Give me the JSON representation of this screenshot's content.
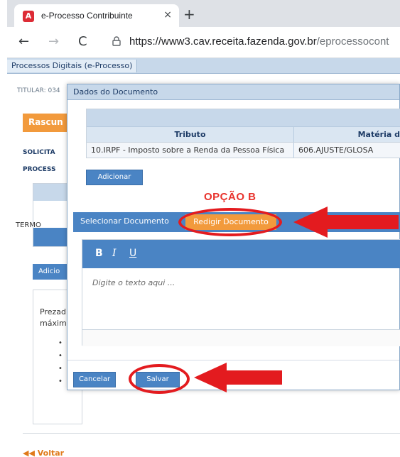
{
  "browser": {
    "tab_title": "e-Processo Contribuinte",
    "tab_close": "×",
    "new_tab": "+",
    "url_host": "https://www3.cav.receita.fazenda.gov.br",
    "url_path": "/eprocessocont",
    "back": "←",
    "forward": "→",
    "reload": "C"
  },
  "page": {
    "breadcrumb": "Processos Digitais (e-Processo)",
    "titular_label": "TITULAR: 034",
    "rascunho_label": "Rascun",
    "solicit_label": "SOLICITA",
    "process_label": "PROCESS",
    "termo_label": "TERMO",
    "adicionar_label": "Adicio",
    "prezado_text": "Prezad",
    "maxim_text": "máxim",
    "bullets": [
      "•",
      "•",
      "•",
      "•"
    ],
    "voltar_label": "Voltar"
  },
  "modal": {
    "title": "Dados do Documento",
    "table": {
      "headers": [
        "Tributo",
        "Matéria d"
      ],
      "rows": [
        [
          "10.IRPF - Imposto sobre a Renda da Pessoa Física",
          "606.AJUSTE/GLOSA"
        ]
      ]
    },
    "adicionar_button": "Adicionar",
    "selecionar_tab": "Selecionar Documento",
    "redigir_tab": "Redigir Documento",
    "editor": {
      "bold": "B",
      "italic": "I",
      "underline": "U",
      "placeholder": "Digite o texto aqui ..."
    },
    "cancelar_button": "Cancelar",
    "salvar_button": "Salvar"
  },
  "annotation": {
    "opcao_text": "OPÇÃO B",
    "color": "#e31b1f"
  },
  "colors": {
    "accent_blue": "#4a84c4",
    "accent_orange": "#f29a3c",
    "header_blue": "#c7d8ea"
  }
}
